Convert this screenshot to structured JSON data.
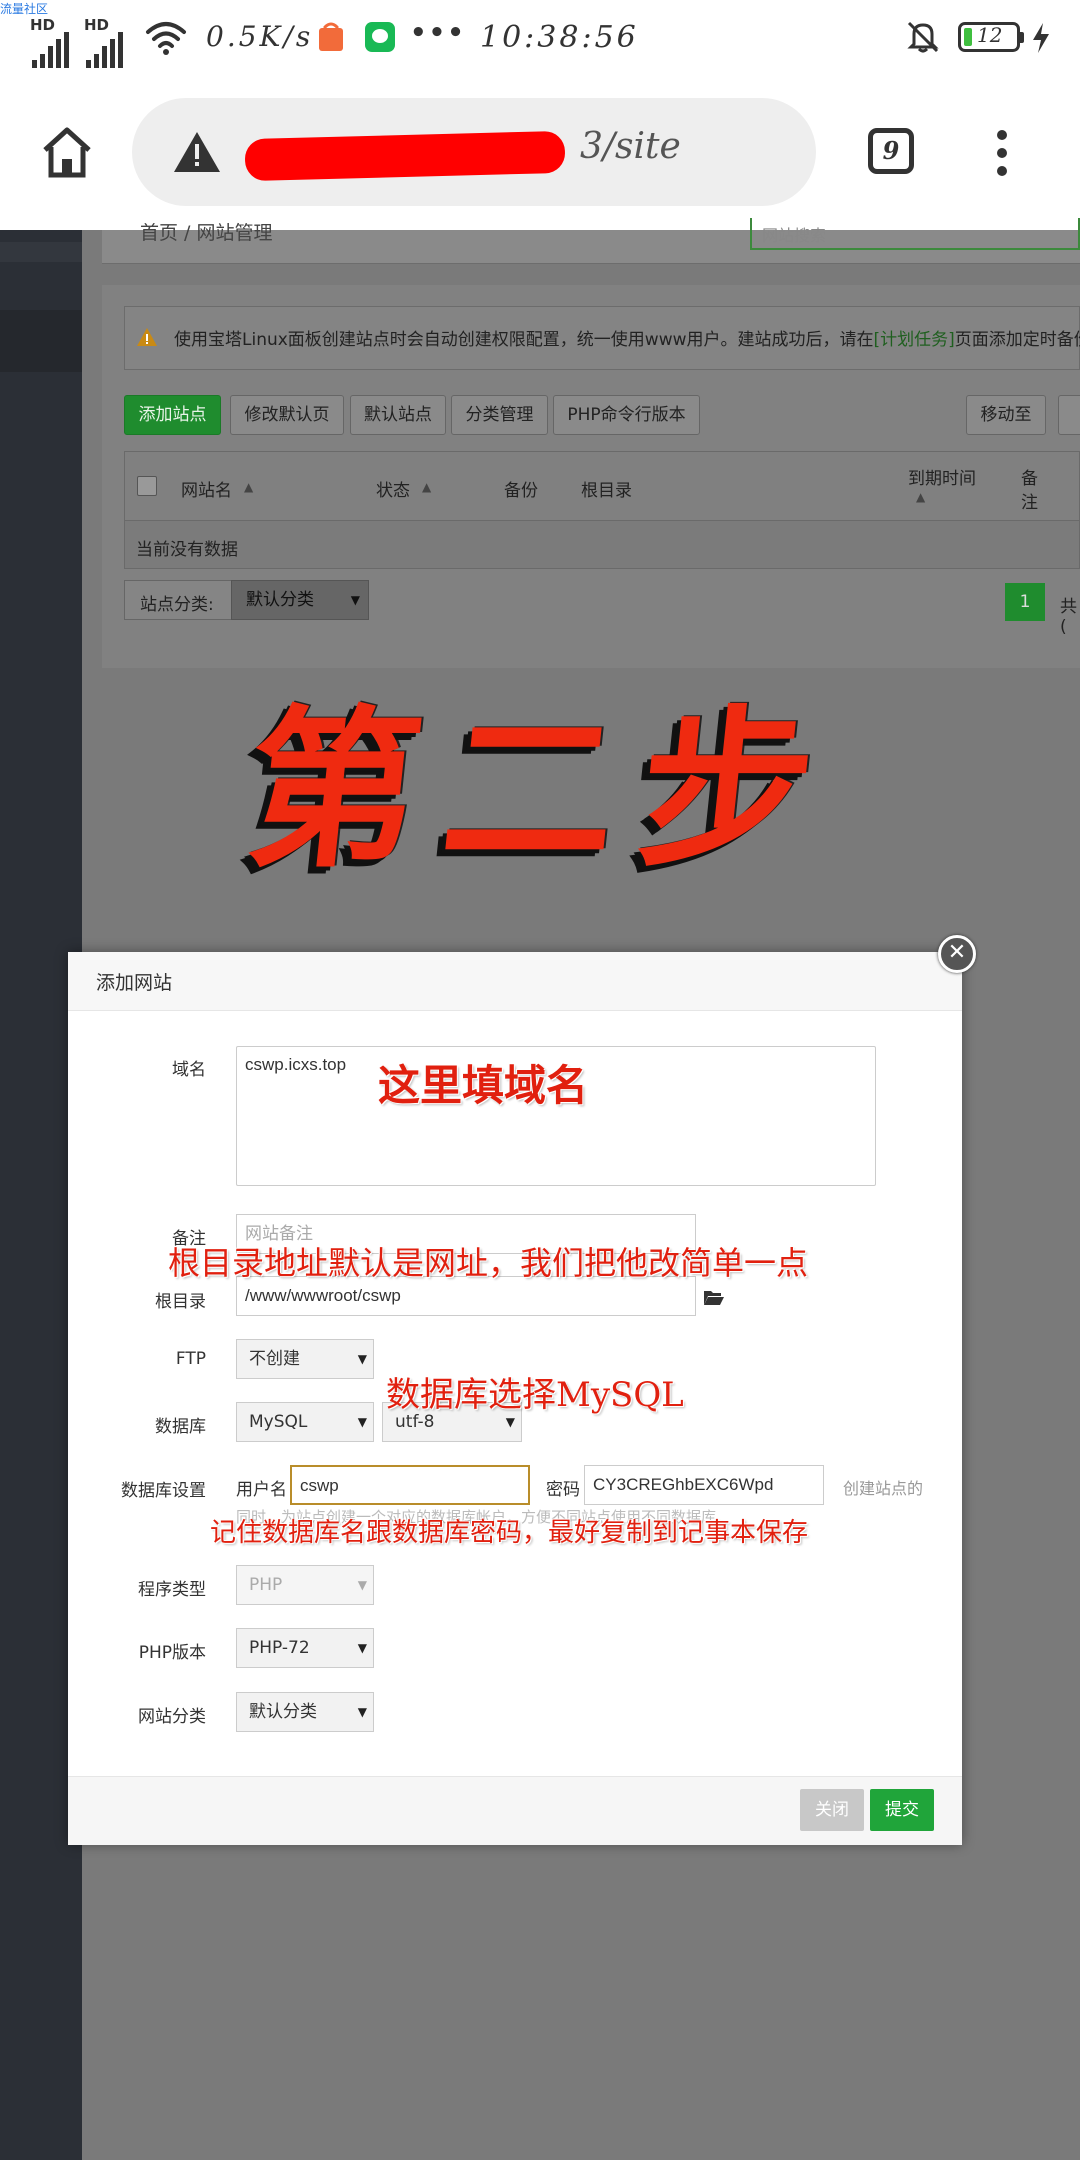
{
  "watermark": "流量社区",
  "status_bar": {
    "signal_1": "HD",
    "signal_2": "HD",
    "net_speed": "0.5K/s",
    "more": "•••",
    "time": "10:38:56",
    "battery": "12"
  },
  "browser": {
    "url_suffix": "3/site",
    "tab_count": "9"
  },
  "page": {
    "breadcrumb": "首页  /  网站管理",
    "search_placeholder": "网站搜索",
    "notice_prefix": "使用宝塔Linux面板创建站点时会自动创建权限配置，统一使用www用户。建站成功后，请在",
    "notice_link": "[计划任务]",
    "notice_suffix": "页面添加定时备份任",
    "buttons": [
      "添加站点",
      "修改默认页",
      "默认站点",
      "分类管理",
      "PHP命令行版本",
      "移动至"
    ],
    "table_headers": {
      "site_name": "网站名",
      "status": "状态",
      "backup": "备份",
      "root": "根目录",
      "expire": "到期时间",
      "note_1": "备",
      "note_2": "注"
    },
    "empty_text": "当前没有数据",
    "category_label": "站点分类:",
    "category_value": "默认分类",
    "pagination_current": "1",
    "pagination_total": "共("
  },
  "annotation_title": "第二步",
  "modal": {
    "title": "添加网站",
    "close_symbol": "✕",
    "fields": {
      "domain_label": "域名",
      "domain_value": "cswp.icxs.top",
      "remark_label": "备注",
      "remark_placeholder": "网站备注",
      "root_label": "根目录",
      "root_value": "/www/wwwroot/cswp",
      "ftp_label": "FTP",
      "ftp_value": "不创建",
      "db_label": "数据库",
      "db_value": "MySQL",
      "db_charset": "utf-8",
      "db_settings_label": "数据库设置",
      "db_user_label": "用户名",
      "db_user_value": "cswp",
      "db_pass_label": "密码",
      "db_pass_value": "CY3CREGhbEXC6Wpd",
      "db_hint_right": "创建站点的",
      "db_hint_below": "同时，为站点创建一个对应的数据库帐户，方便不同站点使用不同数据库",
      "program_type_label": "程序类型",
      "program_type_value": "PHP",
      "php_version_label": "PHP版本",
      "php_version_value": "PHP-72",
      "site_category_label": "网站分类",
      "site_category_value": "默认分类"
    },
    "close_button": "关闭",
    "submit_button": "提交"
  },
  "notes": {
    "domain_note": "这里填域名",
    "root_note": "根目录地址默认是网址，我们把他改简单一点",
    "db_note": "数据库选择MySQL",
    "db_pass_note": "记住数据库名跟数据库密码，最好复制到记事本保存"
  },
  "colors": {
    "accent_green": "#20a53a",
    "annotation_red": "#e1200f",
    "redaction_red": "#ff0000"
  }
}
